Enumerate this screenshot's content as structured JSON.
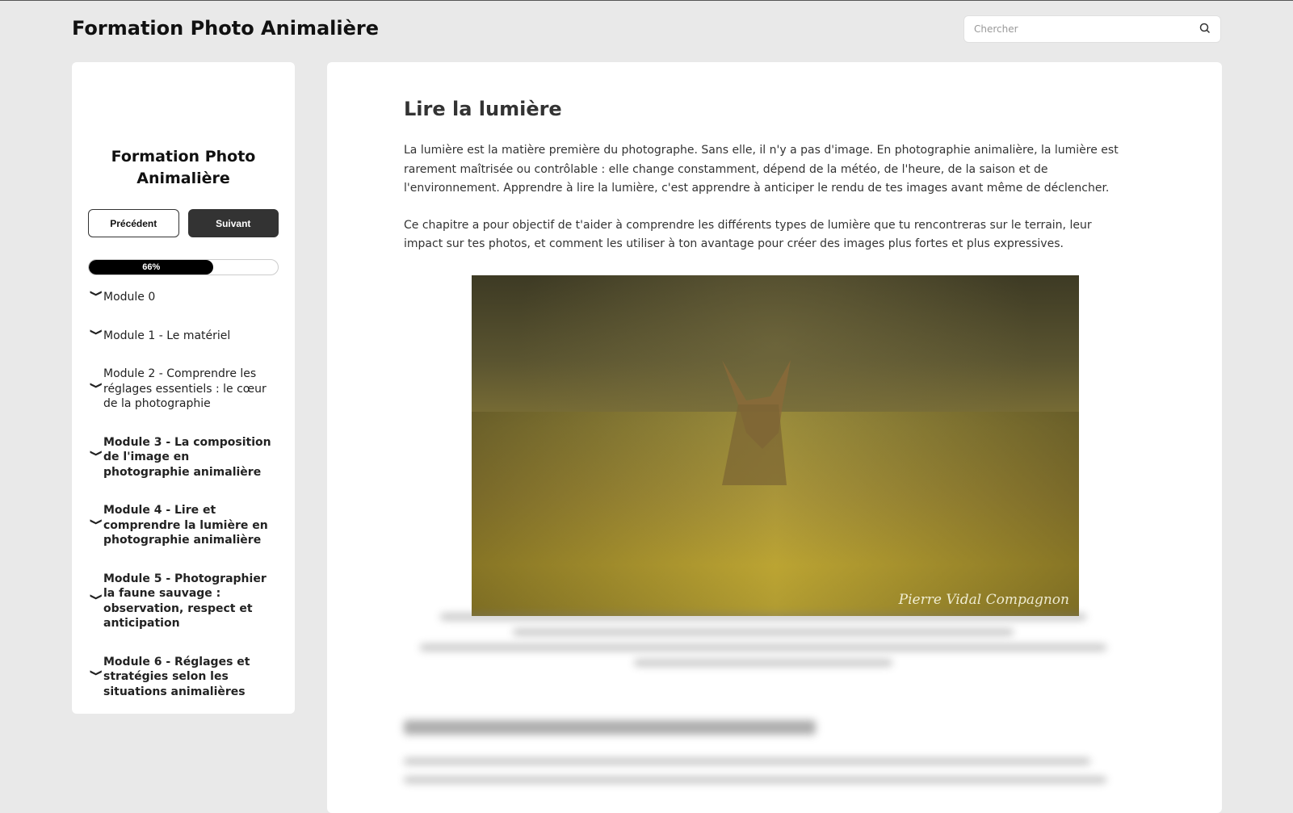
{
  "header": {
    "site_title": "Formation Photo Animalière",
    "search_placeholder": "Chercher"
  },
  "sidebar": {
    "title": "Formation Photo Animalière",
    "prev_label": "Précédent",
    "next_label": "Suivant",
    "progress_percent": 66,
    "progress_label": "66%",
    "modules": [
      {
        "label": "Module 0"
      },
      {
        "label": "Module 1 - Le matériel"
      },
      {
        "label": "Module 2 - Comprendre les réglages essentiels : le cœur de la photographie"
      },
      {
        "label": "Module 3 - La composition de l'image en photographie animalière"
      },
      {
        "label": "Module 4 - Lire et comprendre la lumière en photographie animalière"
      },
      {
        "label": "Module 5 - Photographier la faune sauvage : observation, respect et anticipation"
      },
      {
        "label": "Module 6 - Réglages et stratégies selon les situations animalières"
      }
    ]
  },
  "main": {
    "title": "Lire la lumière",
    "paragraph1": "La lumière est la matière première du photographe. Sans elle, il n'y a pas d'image. En photographie animalière, la lumière est rarement maîtrisée ou contrôlable : elle change constamment, dépend de la météo, de l'heure, de la saison et de l'environnement. Apprendre à lire la lumière, c'est apprendre à anticiper le rendu de tes images avant même de déclencher.",
    "paragraph2": "Ce chapitre a pour objectif de t'aider à comprendre les différents types de lumière que tu rencontreras sur le terrain, leur impact sur tes photos, et comment les utiliser à ton avantage pour créer des images plus fortes et plus expressives.",
    "image_signature": "Pierre Vidal Compagnon"
  }
}
